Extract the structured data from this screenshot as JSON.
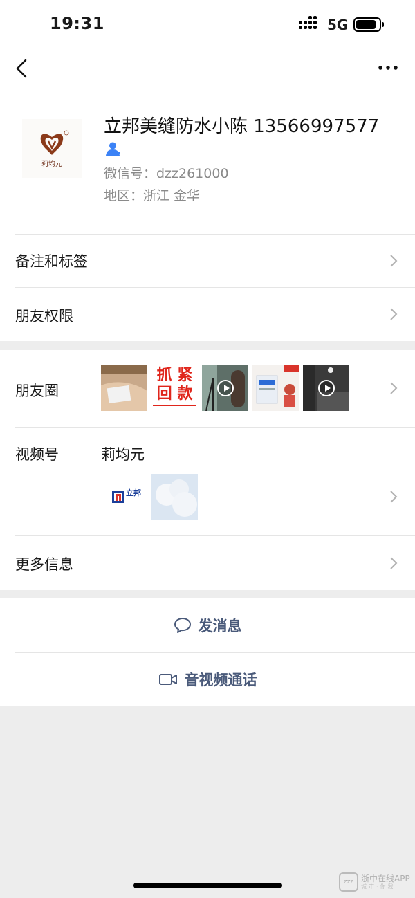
{
  "status_bar": {
    "time": "19:31",
    "network": "5G"
  },
  "profile": {
    "name": "立邦美缝防水小陈 13566997577",
    "avatar_text": "莉均元",
    "wechat_id": "微信号：dzz261000",
    "region": "地区：浙江 金华"
  },
  "rows": {
    "remarks_label": "备注和标签",
    "permissions_label": "朋友权限",
    "moments_label": "朋友圈",
    "channels_label": "视频号",
    "channel_name": "莉均元",
    "more_info_label": "更多信息"
  },
  "moments_thumbs": {
    "t2_line1": "抓 紧",
    "t2_line2": "回 款"
  },
  "channel_thumb_brand": "立邦",
  "actions": {
    "message_label": "发消息",
    "call_label": "音视频通话"
  },
  "watermark": {
    "text": "浙中在线APP",
    "sub": "城市·你我"
  },
  "colors": {
    "background": "#ededed",
    "card": "#ffffff",
    "link_text": "#4a5a7a",
    "secondary_text": "#8a8a8a",
    "verified_icon": "#3b82f6"
  }
}
